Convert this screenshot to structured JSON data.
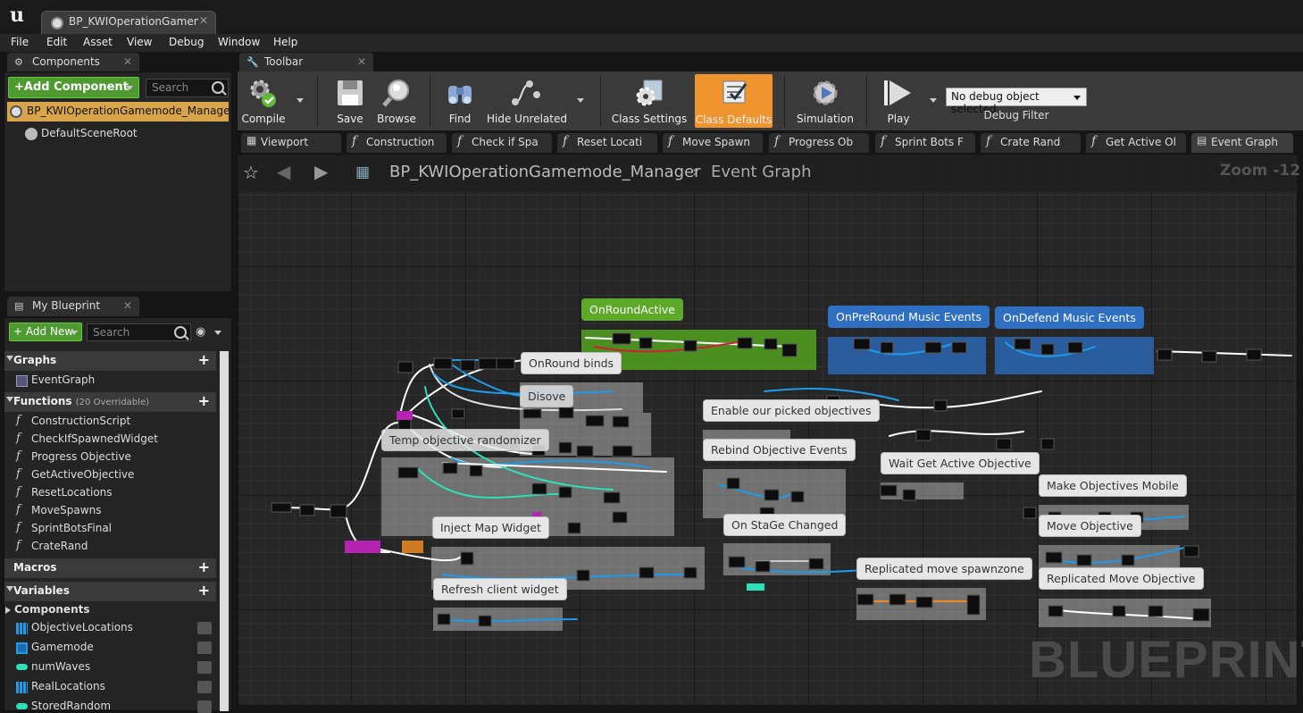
{
  "app": {
    "logo": "u",
    "document_tab": "BP_KWIOperationGamemode_Manager"
  },
  "menu": [
    "File",
    "Edit",
    "Asset",
    "View",
    "Debug",
    "Window",
    "Help"
  ],
  "components_panel": {
    "title": "Components",
    "add_button": "Add Component",
    "search_placeholder": "Search",
    "root": "BP_KWIOperationGamemode_Manager(self)",
    "children": [
      "DefaultSceneRoot"
    ]
  },
  "my_blueprint": {
    "title": "My Blueprint",
    "add_button": "Add New",
    "search_placeholder": "Search",
    "sections": {
      "graphs": "Graphs",
      "functions": "Functions",
      "functions_sub": "(20 Overridable)",
      "macros": "Macros",
      "variables": "Variables",
      "components": "Components"
    },
    "graphs": [
      "EventGraph"
    ],
    "functions": [
      "ConstructionScript",
      "CheckIfSpawnedWidget",
      "Progress Objective",
      "GetActiveObjective",
      "ResetLocations",
      "MoveSpawns",
      "SprintBotsFinal",
      "CrateRand"
    ],
    "variables": [
      {
        "name": "ObjectiveLocations",
        "color": "#1e9bea"
      },
      {
        "name": "Gamemode",
        "color": "#1e9bea"
      },
      {
        "name": "numWaves",
        "color": "#2ce0b8"
      },
      {
        "name": "RealLocations",
        "color": "#1e9bea"
      },
      {
        "name": "StoredRandom",
        "color": "#2ce0b8"
      }
    ]
  },
  "toolbar": {
    "title": "Toolbar",
    "buttons": {
      "compile": "Compile",
      "save": "Save",
      "browse": "Browse",
      "find": "Find",
      "hide_unrelated": "Hide Unrelated",
      "class_settings": "Class Settings",
      "class_defaults": "Class Defaults",
      "simulation": "Simulation",
      "play": "Play"
    },
    "debug_select": "No debug object selected",
    "debug_filter": "Debug Filter"
  },
  "graph_tabs": [
    "Viewport",
    "Construction",
    "Check if Spa",
    "Reset Locati",
    "Move Spawn",
    "Progress Ob",
    "Sprint Bots F",
    "Crate Rand",
    "Get Active Ol",
    "Event Graph"
  ],
  "graph": {
    "breadcrumb_root": "BP_KWIOperationGamemode_Manager",
    "breadcrumb_graph": "Event Graph",
    "zoom": "Zoom -12",
    "watermark": "BLUEPRINT",
    "events": [
      "OnRoundActive",
      "OnPreRound Music Events",
      "OnDefend Music Events"
    ],
    "comments": [
      "OnRound binds",
      "Disove",
      "Temp objective randomizer",
      "Enable our picked objectives",
      "Rebind Objective Events",
      "Wait Get Active Objective",
      "Make Objectives Mobile",
      "Move Objective",
      "Replicated Move Objective",
      "On StaGe Changed",
      "Replicated move spawnzone",
      "Inject Map Widget",
      "Refresh client widget"
    ]
  }
}
